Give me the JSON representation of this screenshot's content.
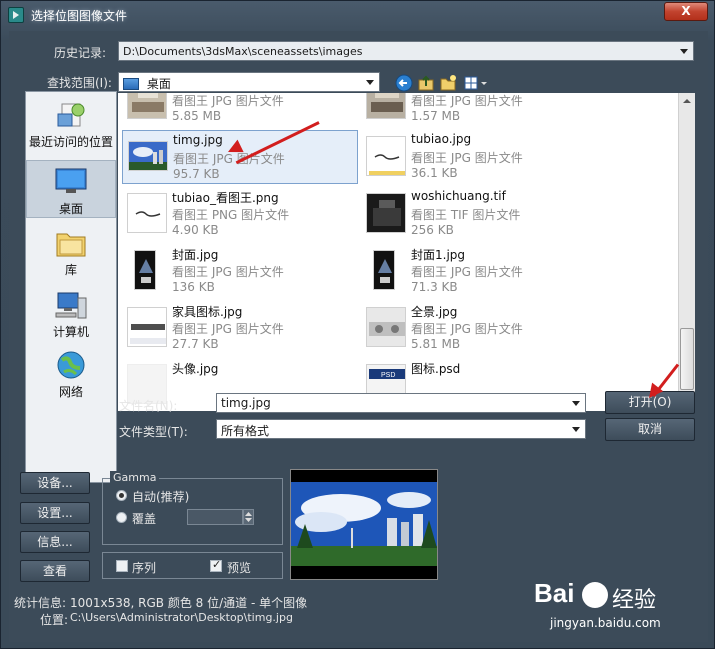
{
  "window": {
    "title": "选择位图图像文件",
    "close": "X"
  },
  "history": {
    "label": "历史记录:",
    "value": "D:\\Documents\\3dsMax\\sceneassets\\images"
  },
  "lookin": {
    "label": "查找范围(I):",
    "value": "桌面"
  },
  "places": [
    {
      "label": "最近访问的位置",
      "icon": "recent-places-icon"
    },
    {
      "label": "桌面",
      "icon": "desktop-icon"
    },
    {
      "label": "库",
      "icon": "library-icon"
    },
    {
      "label": "计算机",
      "icon": "computer-icon"
    },
    {
      "label": "网络",
      "icon": "network-icon"
    }
  ],
  "files": [
    {
      "name": "",
      "type": "看图王 JPG 图片文件",
      "size": "5.85 MB",
      "thumb": "room"
    },
    {
      "name": "",
      "type": "看图王 JPG 图片文件",
      "size": "1.57 MB",
      "thumb": "room"
    },
    {
      "name": "timg.jpg",
      "type": "看图王 JPG 图片文件",
      "size": "95.7 KB",
      "thumb": "sky",
      "selected": true
    },
    {
      "name": "tubiao.jpg",
      "type": "看图王 JPG 图片文件",
      "size": "36.1 KB",
      "thumb": "logo"
    },
    {
      "name": "tubiao_看图王.png",
      "type": "看图王 PNG 图片文件",
      "size": "4.90 KB",
      "thumb": "logo2"
    },
    {
      "name": "woshichuang.tif",
      "type": "看图王 TIF 图片文件",
      "size": "256 KB",
      "thumb": "dark"
    },
    {
      "name": "封面.jpg",
      "type": "看图王 JPG 图片文件",
      "size": "136 KB",
      "thumb": "cover"
    },
    {
      "name": "封面1.jpg",
      "type": "看图王 JPG 图片文件",
      "size": "71.3 KB",
      "thumb": "cover"
    },
    {
      "name": "家具图标.jpg",
      "type": "看图王 JPG 图片文件",
      "size": "27.7 KB",
      "thumb": "furniture"
    },
    {
      "name": "全景.jpg",
      "type": "看图王 JPG 图片文件",
      "size": "5.81 MB",
      "thumb": "pano"
    },
    {
      "name": "头像.jpg",
      "type": "",
      "size": "",
      "thumb": "plain"
    },
    {
      "name": "图标.psd",
      "type": "",
      "size": "",
      "thumb": "psd"
    }
  ],
  "filename": {
    "label": "文件名(N):",
    "value": "timg.jpg"
  },
  "filetype": {
    "label": "文件类型(T):",
    "value": "所有格式"
  },
  "buttons": {
    "open": "打开(O)",
    "cancel": "取消",
    "setup1": "设备...",
    "setup2": "设置...",
    "info": "信息...",
    "view": "查看"
  },
  "gamma": {
    "title": "Gamma",
    "auto": "自动(推荐)",
    "override": "覆盖"
  },
  "options": {
    "sequence": "序列",
    "preview": "预览"
  },
  "stats": {
    "info_label": "统计信息:",
    "info_value": "1001x538, RGB 颜色 8 位/通道 - 单个图像",
    "loc_label": "位置:",
    "loc_value": "C:\\Users\\Administrator\\Desktop\\timg.jpg"
  },
  "watermark": {
    "brand": "Bai",
    "brand2": "经验",
    "url": "jingyan.baidu.com"
  },
  "colors": {
    "accent": "#d21e1e",
    "selection": "#e5eef9"
  }
}
